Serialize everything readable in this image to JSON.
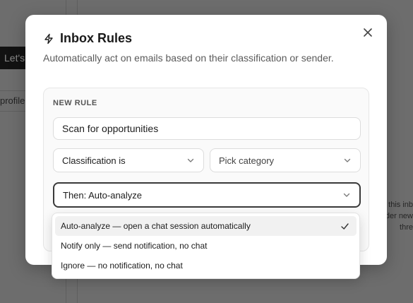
{
  "background": {
    "button_label": "Let's",
    "profile_label": "profile",
    "right_lines": [
      "this inb",
      "der new",
      "thre"
    ]
  },
  "modal": {
    "title": "Inbox Rules",
    "subtitle": "Automatically act on emails based on their classification or sender.",
    "section_label": "NEW RULE",
    "rule_name_value": "Scan for opportunities",
    "condition_select": "Classification is",
    "category_select": "Pick category",
    "action_select": "Then: Auto-analyze"
  },
  "dropdown": {
    "options": [
      "Auto-analyze — open a chat session automatically",
      "Notify only — send notification, no chat",
      "Ignore — no notification, no chat"
    ],
    "selected_index": 0
  },
  "icons": {
    "title": "lightning-icon",
    "close": "close-icon",
    "select": "chevron-down-icon",
    "selected": "check-icon"
  },
  "colors": {
    "overlay": "#6d6d6d",
    "modal_bg": "#ffffff",
    "card_bg": "#fafafa",
    "focus_border": "#3a3a3a",
    "option_hover": "#f1f1f1"
  }
}
